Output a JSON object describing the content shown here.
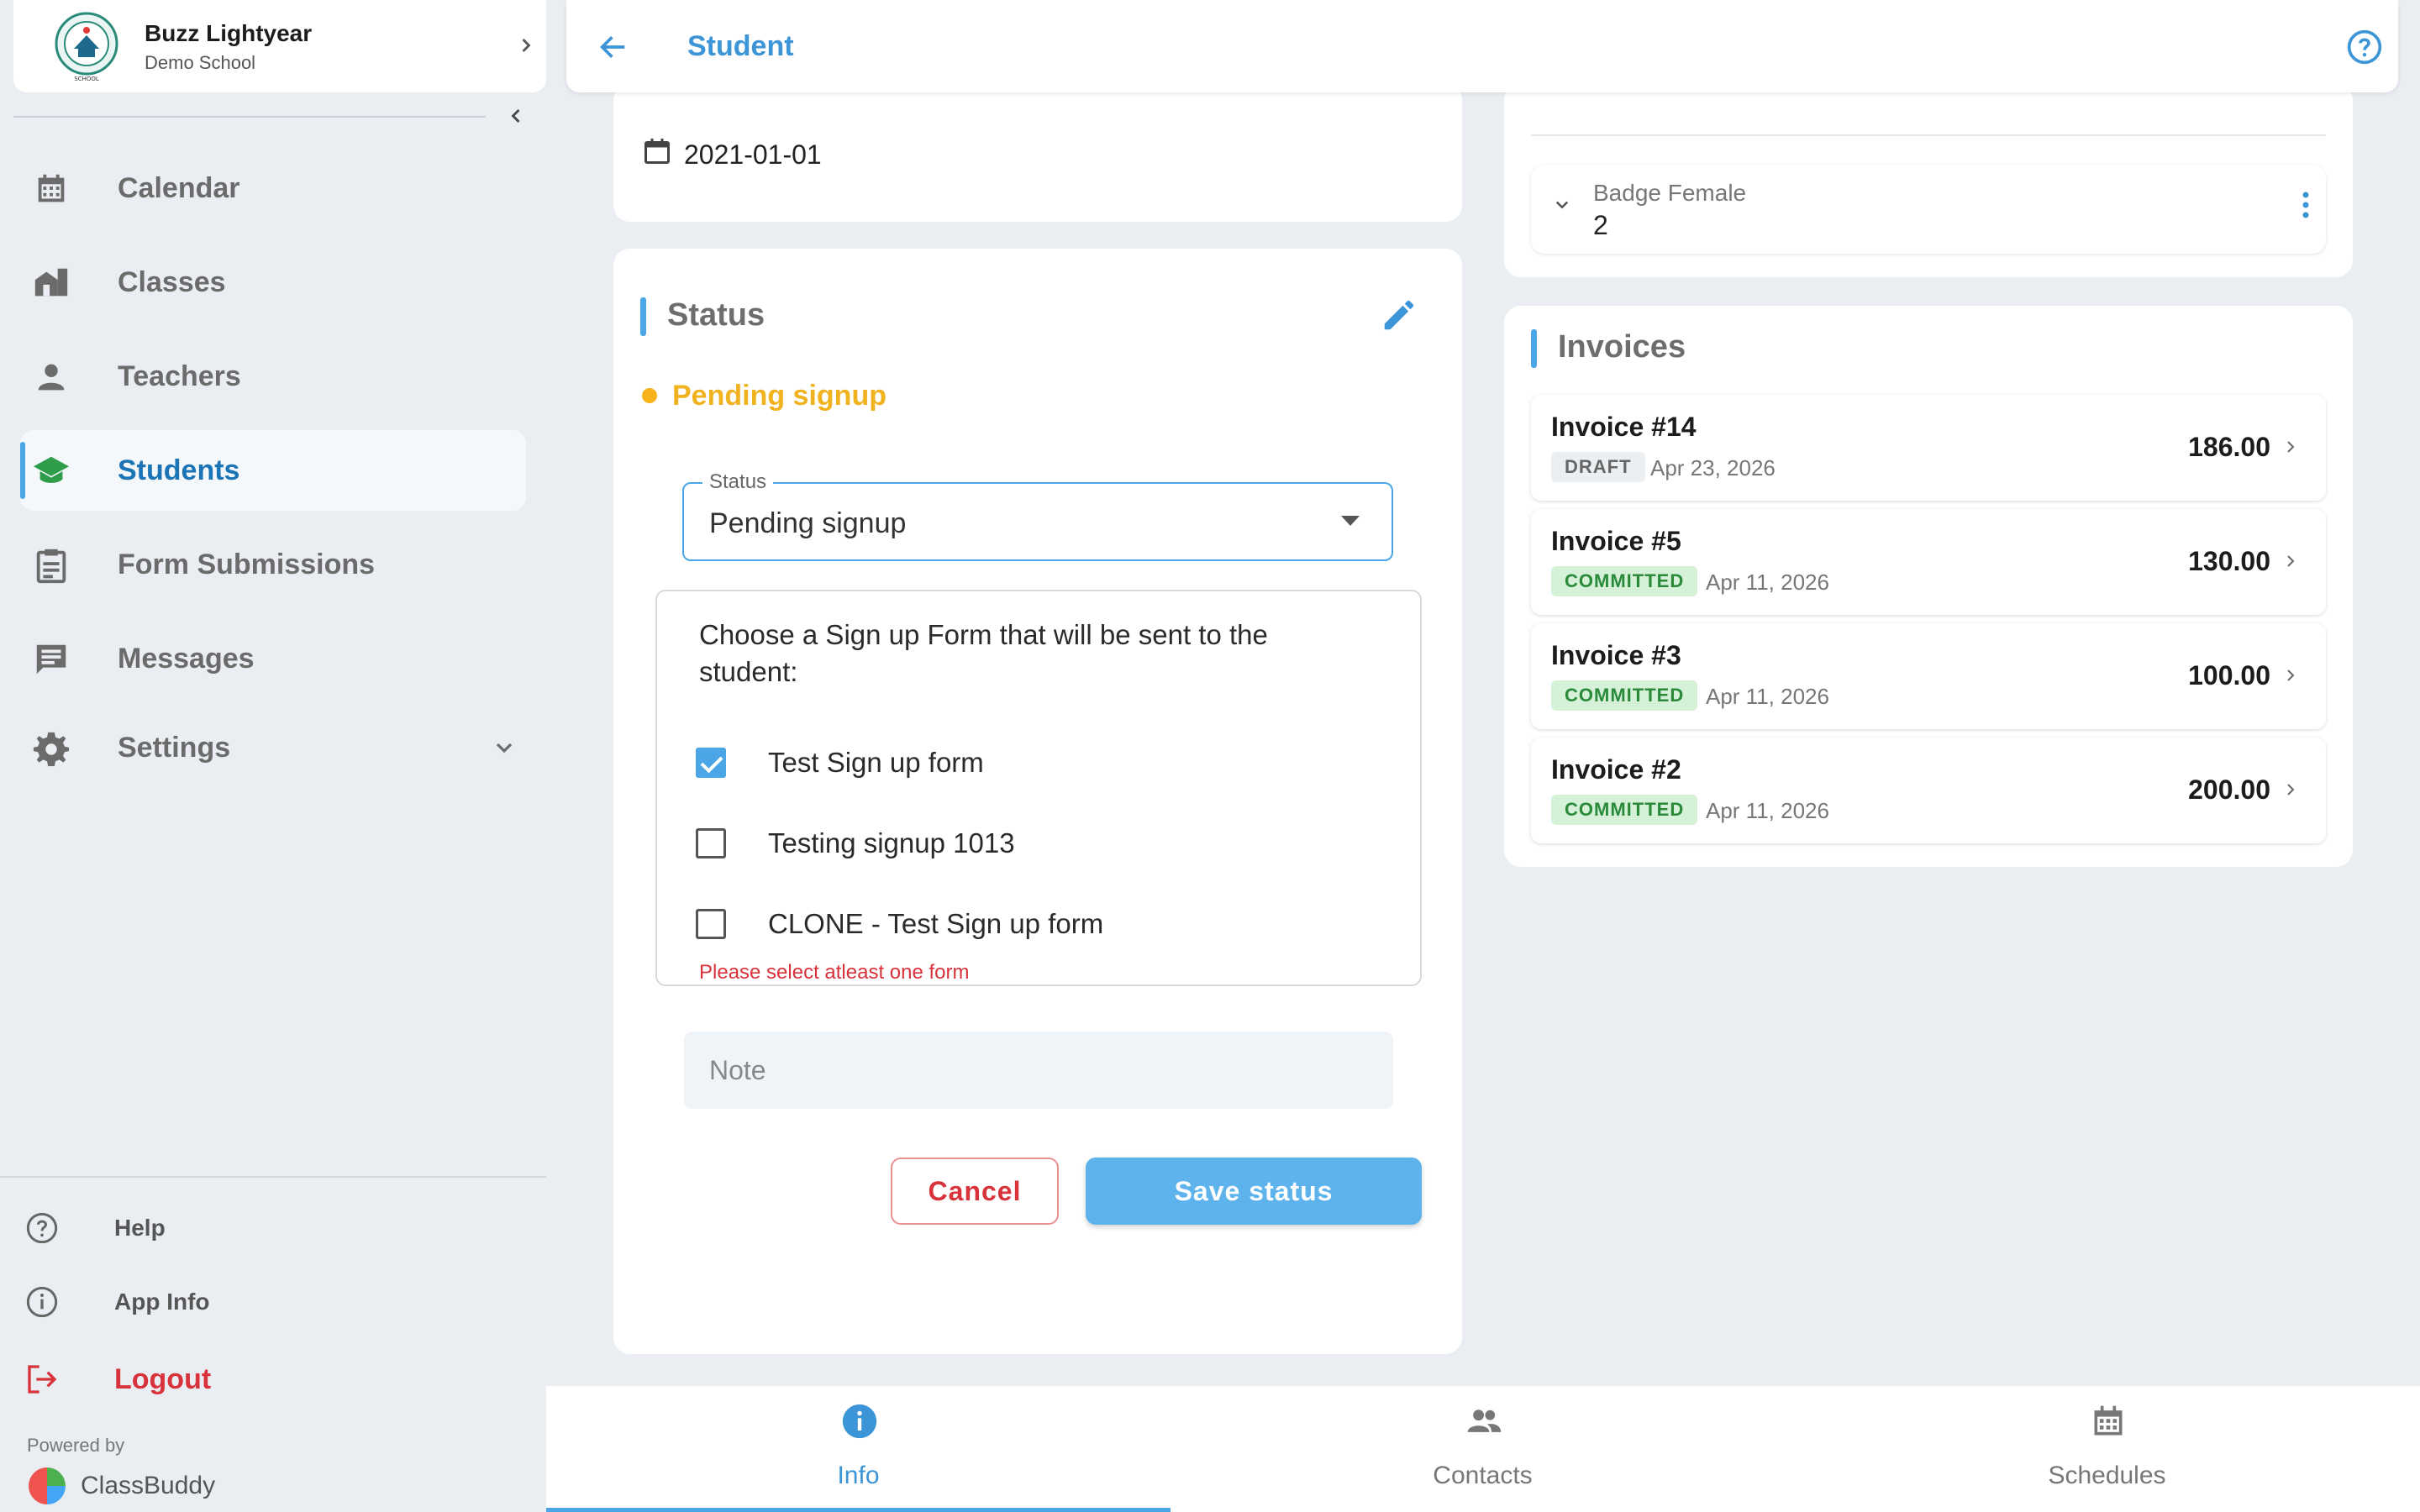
{
  "school": {
    "name": "Buzz Lightyear",
    "subtitle": "Demo School"
  },
  "sidebar": {
    "items": [
      {
        "label": "Calendar",
        "icon": "calendar-icon"
      },
      {
        "label": "Classes",
        "icon": "classes-icon"
      },
      {
        "label": "Teachers",
        "icon": "teacher-icon"
      },
      {
        "label": "Students",
        "icon": "graduation-cap-icon",
        "active": true
      },
      {
        "label": "Form Submissions",
        "icon": "clipboard-icon"
      },
      {
        "label": "Messages",
        "icon": "message-icon"
      },
      {
        "label": "Settings",
        "icon": "gear-icon"
      }
    ],
    "footer": [
      {
        "label": "Help",
        "icon": "help-circle-icon"
      },
      {
        "label": "App Info",
        "icon": "info-circle-icon"
      },
      {
        "label": "Logout",
        "icon": "logout-icon"
      }
    ],
    "powered_by": "Powered by",
    "brand": "ClassBuddy"
  },
  "topbar": {
    "title": "Student"
  },
  "date_card": {
    "value": "2021-01-01"
  },
  "status_card": {
    "title": "Status",
    "current_status": "Pending signup",
    "status_color": "#f0b21e",
    "select": {
      "legend": "Status",
      "value": "Pending signup"
    },
    "form_prompt": "Choose a Sign up Form that will be sent to the student:",
    "forms": [
      {
        "label": "Test Sign up form",
        "checked": true
      },
      {
        "label": "Testing signup 1013",
        "checked": false
      },
      {
        "label": "CLONE - Test Sign up form",
        "checked": false
      }
    ],
    "error": "Please select atleast one form",
    "note_placeholder": "Note",
    "cancel_label": "Cancel",
    "save_label": "Save status"
  },
  "badges": {
    "label": "Badge Female",
    "value": "2"
  },
  "invoices": {
    "title": "Invoices",
    "items": [
      {
        "title": "Invoice #14",
        "status": "DRAFT",
        "date": "Apr 23, 2026",
        "amount": "186.00"
      },
      {
        "title": "Invoice #5",
        "status": "COMMITTED",
        "date": "Apr 11, 2026",
        "amount": "130.00"
      },
      {
        "title": "Invoice #3",
        "status": "COMMITTED",
        "date": "Apr 11, 2026",
        "amount": "100.00"
      },
      {
        "title": "Invoice #2",
        "status": "COMMITTED",
        "date": "Apr 11, 2026",
        "amount": "200.00"
      }
    ]
  },
  "bottom_nav": {
    "tabs": [
      {
        "label": "Info",
        "icon": "info-icon",
        "active": true
      },
      {
        "label": "Contacts",
        "icon": "contacts-icon"
      },
      {
        "label": "Schedules",
        "icon": "calendar-icon"
      }
    ]
  },
  "colors": {
    "accent": "#4aa6e5",
    "danger": "#d8323b",
    "warning": "#f0b21e",
    "success": "#2a8a3a"
  }
}
